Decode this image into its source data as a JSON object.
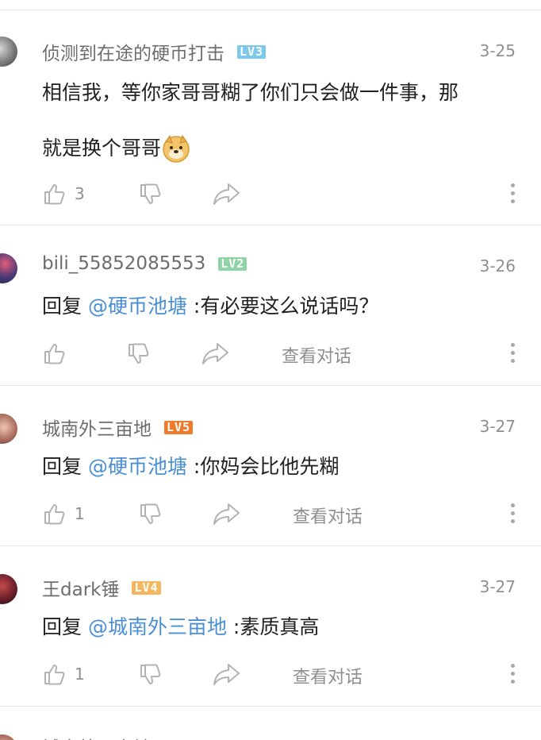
{
  "comments": [
    {
      "username": "侦测到在途的硬币打击",
      "level": "LV3",
      "level_color": "#7ec8ea",
      "date": "3-25",
      "text_line1": "相信我，等你家哥哥糊了你们只会做一件事，那",
      "text_line2": "就是换个哥哥",
      "emoji": "doge-emoji",
      "like_count": "3"
    },
    {
      "username": "bili_55852085553",
      "level": "LV2",
      "level_color": "#8fd4a4",
      "date": "3-26",
      "reply_prefix": "回复 ",
      "mention": "@硬币池塘",
      "reply_text": " :有必要这么说话吗？",
      "like_count": "",
      "view_conversation": "查看对话"
    },
    {
      "username": "城南外三亩地",
      "level": "LV5",
      "level_color": "#f07a2a",
      "date": "3-27",
      "reply_prefix": "回复 ",
      "mention": "@硬币池塘",
      "reply_text": " :你妈会比他先糊",
      "like_count": "1",
      "view_conversation": "查看对话"
    },
    {
      "username": "王dark锤",
      "level": "LV4",
      "level_color": "#f5b660",
      "date": "3-27",
      "reply_prefix": "回复 ",
      "mention": "@城南外三亩地",
      "reply_text": " :素质真高",
      "like_count": "1",
      "view_conversation": "查看对话"
    }
  ],
  "partial_next": {
    "username": "城南外三亩地",
    "level_color": "#f07a2a"
  },
  "icons": {
    "like": "thumbs-up-icon",
    "dislike": "thumbs-down-icon",
    "share": "share-icon",
    "more": "more-vertical-icon"
  }
}
